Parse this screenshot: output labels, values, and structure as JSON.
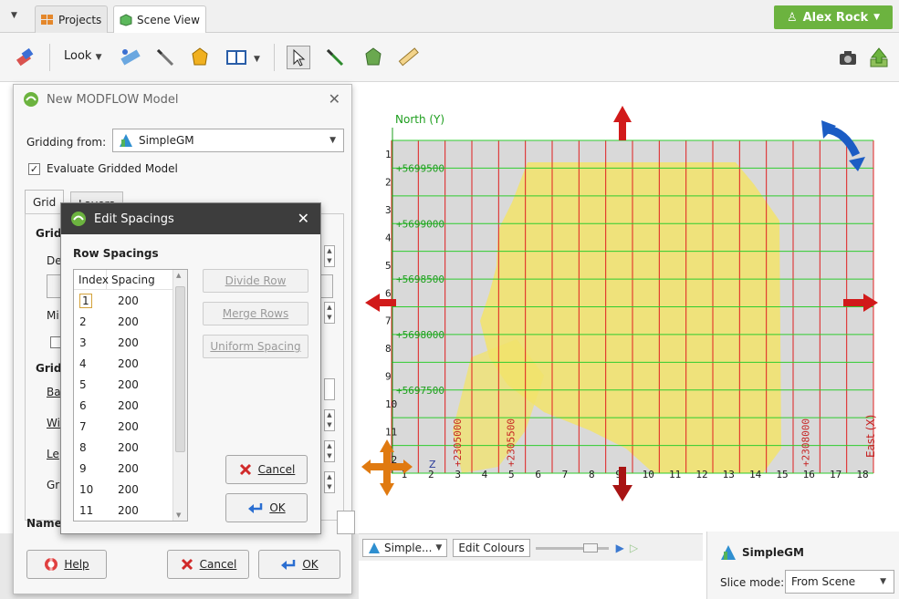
{
  "tabs": {
    "projects_label": "Projects",
    "scene_view_label": "Scene View"
  },
  "user": {
    "name": "Alex Rock"
  },
  "toolbar": {
    "look_label": "Look"
  },
  "modflow_dialog": {
    "title": "New MODFLOW Model",
    "gridding_from_label": "Gridding from:",
    "gridding_from_value": "SimpleGM",
    "evaluate_label": "Evaluate Gridded Model",
    "evaluate_checked": true,
    "tab_grid": "Grid",
    "tab_layers": "Layers",
    "stub_labels": [
      "Grid",
      "De",
      "Mi",
      "Grid",
      "Ba",
      "Wi",
      "Le",
      "Gr"
    ],
    "name_label": "Name",
    "help_label": "Help",
    "cancel_label": "Cancel",
    "ok_label": "OK"
  },
  "spacings_dialog": {
    "title": "Edit Spacings",
    "row_spacings_label": "Row Spacings",
    "col_index": "Index",
    "col_spacing": "Spacing",
    "rows": [
      {
        "index": "1",
        "spacing": "200"
      },
      {
        "index": "2",
        "spacing": "200"
      },
      {
        "index": "3",
        "spacing": "200"
      },
      {
        "index": "4",
        "spacing": "200"
      },
      {
        "index": "5",
        "spacing": "200"
      },
      {
        "index": "6",
        "spacing": "200"
      },
      {
        "index": "7",
        "spacing": "200"
      },
      {
        "index": "8",
        "spacing": "200"
      },
      {
        "index": "9",
        "spacing": "200"
      },
      {
        "index": "10",
        "spacing": "200"
      },
      {
        "index": "11",
        "spacing": "200"
      }
    ],
    "divide_row_label": "Divide Row",
    "merge_rows_label": "Merge Rows",
    "uniform_spacing_label": "Uniform Spacing",
    "cancel_label": "Cancel",
    "ok_label": "OK"
  },
  "scene": {
    "north_label": "North (Y)",
    "east_label": "East (X)",
    "row_numbers": [
      "1",
      "2",
      "3",
      "4",
      "5",
      "6",
      "7",
      "8",
      "9",
      "10",
      "11",
      "12"
    ],
    "col_numbers": [
      "1",
      "2",
      "3",
      "4",
      "5",
      "6",
      "7",
      "8",
      "9",
      "10",
      "11",
      "12",
      "13",
      "14",
      "15",
      "16",
      "17",
      "18"
    ],
    "north_ticks": [
      "+5699500",
      "+5699000",
      "+5698500",
      "+5698000",
      "+5697500"
    ],
    "east_ticks": [
      "+2305000",
      "+2305500",
      "+2308000"
    ],
    "z_label": "Z"
  },
  "bottom_bar": {
    "object_select": "Simple...",
    "edit_colours_label": "Edit Colours"
  },
  "right_panel": {
    "object_name": "SimpleGM",
    "slice_mode_label": "Slice mode:",
    "slice_mode_value": "From Scene"
  },
  "colors": {
    "accent_green": "#6cb33f",
    "grid_red": "#e02020",
    "grid_green": "#2ecc2e",
    "arrow_red": "#d11a1a",
    "model_yellow": "#f2e36a"
  }
}
